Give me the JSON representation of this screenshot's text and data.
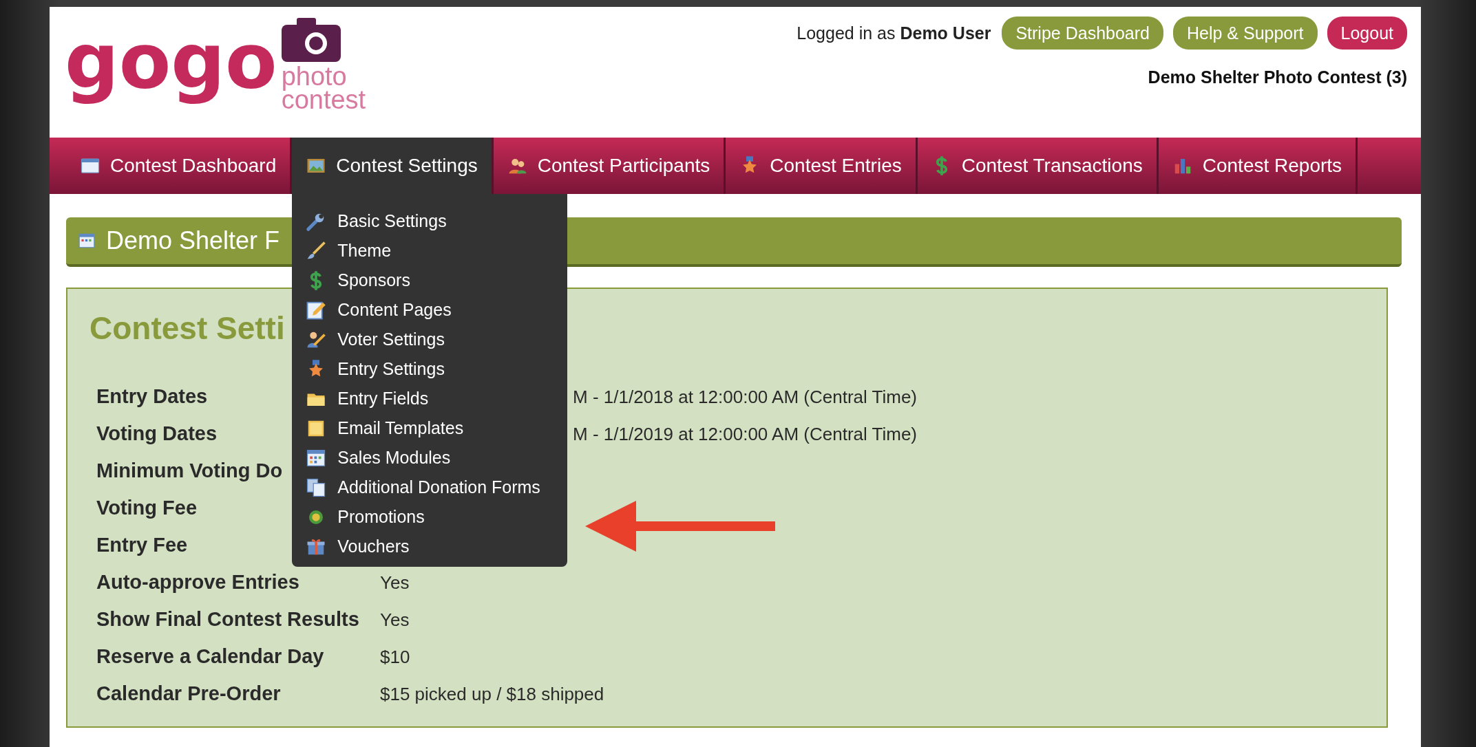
{
  "logo": {
    "wordmark": "gogo",
    "tagline_1": "photo",
    "tagline_2": "contest"
  },
  "header": {
    "login_text": "Logged in as **Demo User**",
    "buttons": [
      {
        "label": "Stripe Dashboard",
        "kind": "secondary"
      },
      {
        "label": "Help & Support",
        "kind": "secondary"
      },
      {
        "label": "Logout",
        "kind": "danger"
      }
    ],
    "contest_name": "Demo Shelter Photo Contest (3)"
  },
  "nav": [
    {
      "label": "Contest Dashboard",
      "selected": false
    },
    {
      "label": "Contest Settings",
      "selected": true
    },
    {
      "label": "Contest Participants",
      "selected": false
    },
    {
      "label": "Contest Entries",
      "selected": false
    },
    {
      "label": "Contest Transactions",
      "selected": false
    },
    {
      "label": "Contest Reports",
      "selected": false
    }
  ],
  "dropdown": [
    {
      "label": "Basic Settings"
    },
    {
      "label": "Theme"
    },
    {
      "label": "Sponsors"
    },
    {
      "label": "Content Pages"
    },
    {
      "label": "Voter Settings"
    },
    {
      "label": "Entry Settings"
    },
    {
      "label": "Entry Fields"
    },
    {
      "label": "Email Templates"
    },
    {
      "label": "Sales Modules"
    },
    {
      "label": "Additional Donation Forms"
    },
    {
      "label": "Promotions"
    },
    {
      "label": "Vouchers"
    }
  ],
  "title_bar": {
    "title": "Demo Shelter F"
  },
  "settings_panel": {
    "heading": "Contest Setti",
    "rows": [
      {
        "label": "Entry Dates",
        "value": "M - 1/1/2018 at 12:00:00 AM (Central Time)",
        "kind": "behind_menu"
      },
      {
        "label": "Voting Dates",
        "value": "M - 1/1/2019 at 12:00:00 AM (Central Time)",
        "kind": "behind_menu"
      },
      {
        "label": "Minimum Voting Do",
        "kind": "hidden"
      },
      {
        "label": "Voting Fee",
        "kind": "hidden"
      },
      {
        "label": "Entry Fee",
        "kind": "hidden"
      },
      {
        "label": "Auto-approve Entries",
        "value": "Yes",
        "kind": "full"
      },
      {
        "label": "Show Final Contest Results",
        "value": "Yes",
        "kind": "full"
      },
      {
        "label": "Reserve a Calendar Day",
        "value": "$10",
        "kind": "full"
      },
      {
        "label": "Calendar Pre-Order",
        "value": "$15 picked up / $18 shipped",
        "kind": "full"
      }
    ]
  }
}
